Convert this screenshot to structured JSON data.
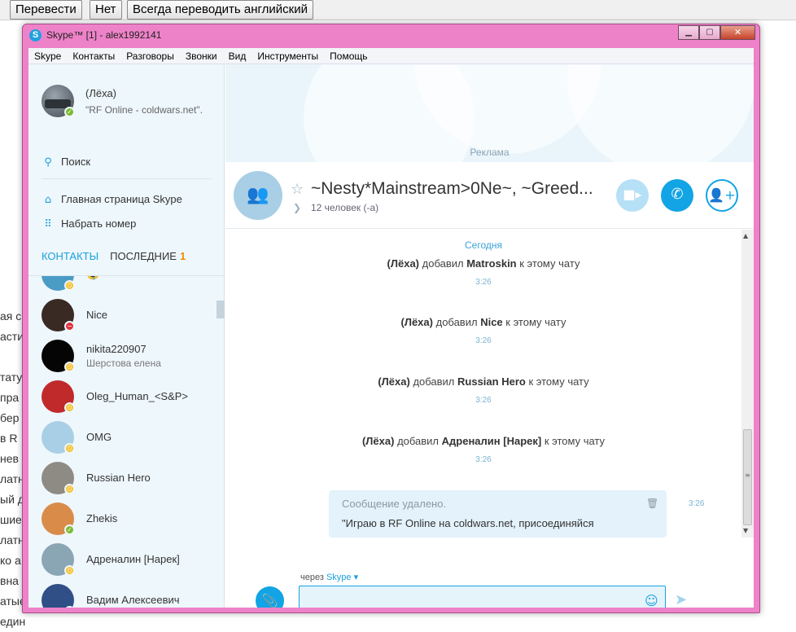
{
  "translate_bar": {
    "translate": "Перевести",
    "no": "Нет",
    "always": "Всегда переводить английский"
  },
  "background_text": [
    "ая с",
    "асти",
    "",
    "тату",
    "пра",
    "бер",
    "в R",
    "нев",
    "латн",
    "ый д",
    "шие",
    "латн",
    "ко а",
    "вна",
    "атые",
    "един"
  ],
  "window": {
    "title": "Skype™ [1] - alex1992141",
    "logo_letter": "S",
    "controls": {
      "minimize": "▁",
      "maximize": "▢",
      "close": "✕"
    }
  },
  "menu": [
    "Skype",
    "Контакты",
    "Разговоры",
    "Звонки",
    "Вид",
    "Инструменты",
    "Помощь"
  ],
  "sidebar": {
    "profile": {
      "name": "(Лёха)",
      "mood": "\"RF Online - coldwars.net\"."
    },
    "search_label": "Поиск",
    "home_label": "Главная страница Skype",
    "dial_label": "Набрать номер",
    "tabs": {
      "contacts": "КОНТАКТЫ",
      "recent": "ПОСЛЕДНИЕ",
      "recent_count": "1"
    },
    "contacts": [
      {
        "name": "🤤",
        "sub": "",
        "status": "away",
        "status_glyph": "⏲",
        "avatar": "#4a9cc4"
      },
      {
        "name": "Nice",
        "sub": "",
        "status": "busy",
        "status_glyph": "−",
        "avatar": "#3a2a24"
      },
      {
        "name": "nikita220907",
        "sub": "Шерстова елена",
        "status": "away",
        "status_glyph": "⏲",
        "avatar": "#050505"
      },
      {
        "name": "Oleg_Human_<S&P>",
        "sub": "",
        "status": "away",
        "status_glyph": "⏲",
        "avatar": "#c02a2a"
      },
      {
        "name": "OMG",
        "sub": "",
        "status": "away",
        "status_glyph": "⏲",
        "avatar": "#a9cfe6"
      },
      {
        "name": "Russian Hero",
        "sub": "",
        "status": "away",
        "status_glyph": "⏲",
        "avatar": "#8e8a84"
      },
      {
        "name": "Zhekis",
        "sub": "",
        "status": "online",
        "status_glyph": "✓",
        "avatar": "#d98c4a"
      },
      {
        "name": "Адреналин [Нарек]",
        "sub": "",
        "status": "away",
        "status_glyph": "⏲",
        "avatar": "#8aa6b4"
      },
      {
        "name": "Вадим Алексеевич",
        "sub": "",
        "status": "away",
        "status_glyph": "⏲",
        "avatar": "#2f4f86"
      }
    ]
  },
  "ad_label": "Реклама",
  "conversation": {
    "title": "~Nesty*Mainstream>0Ne~, ~Greed...",
    "participants": "12 человек (-а)"
  },
  "messages": {
    "date": "Сегодня",
    "events": [
      {
        "actor": "(Лёха)",
        "verb": "добавил",
        "target": "Matroskin",
        "tail": "к этому чату",
        "time": "3:26"
      },
      {
        "actor": "(Лёха)",
        "verb": "добавил",
        "target": "Nice",
        "tail": "к этому чату",
        "time": "3:26"
      },
      {
        "actor": "(Лёха)",
        "verb": "добавил",
        "target": "Russian Hero",
        "tail": "к этому чату",
        "time": "3:26"
      },
      {
        "actor": "(Лёха)",
        "verb": "добавил",
        "target": "Адреналин [Нарек]",
        "tail": "к этому чату",
        "time": "3:26"
      }
    ],
    "bubble": {
      "deleted": "Сообщение удалено.",
      "text": "\"Играю в RF Online на coldwars.net, присоединяйся",
      "time": "3:26"
    }
  },
  "compose": {
    "via_prefix": "через",
    "via_service": "Skype",
    "input_value": ""
  },
  "colors": {
    "accent": "#12a4e4",
    "window_frame": "#ee82c8",
    "away": "#f6c02a",
    "online": "#7cba2e",
    "busy": "#e0323c"
  },
  "icons": {
    "search": "search-icon",
    "home": "home-icon",
    "dialpad": "dialpad-icon",
    "star": "star-icon",
    "video": "video-icon",
    "call": "phone-icon",
    "add": "add-person-icon",
    "attach": "paperclip-icon",
    "emoji": "emoji-icon",
    "send": "send-icon",
    "trash": "trash-icon"
  }
}
